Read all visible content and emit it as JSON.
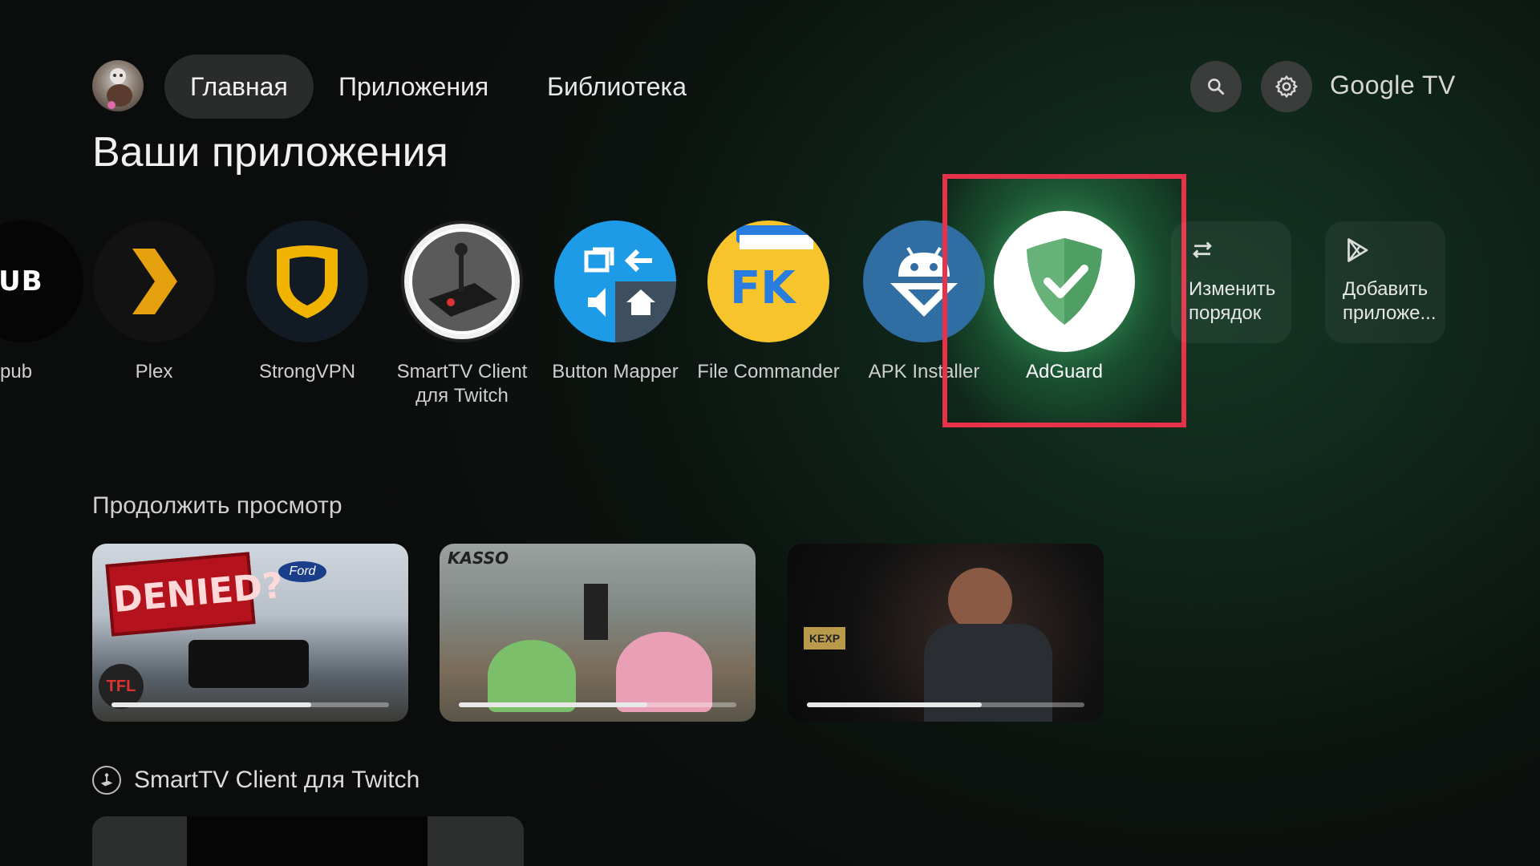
{
  "nav": {
    "tabs": [
      {
        "label": "Главная",
        "active": true
      },
      {
        "label": "Приложения",
        "active": false
      },
      {
        "label": "Библиотека",
        "active": false
      }
    ],
    "search_icon": "search-icon",
    "settings_icon": "gear-icon",
    "brand": "Google TV"
  },
  "apps_section": {
    "title": "Ваши приложения",
    "apps": [
      {
        "label": "pub",
        "icon_text": "PUB"
      },
      {
        "label": "Plex"
      },
      {
        "label": "StrongVPN"
      },
      {
        "label": "SmartTV Client для Twitch"
      },
      {
        "label": "Button Mapper"
      },
      {
        "label": "File Commander",
        "icon_text": "FK"
      },
      {
        "label": "APK Installer"
      },
      {
        "label": "AdGuard",
        "focused": true
      }
    ],
    "actions": [
      {
        "label": "Изменить порядок",
        "icon": "reorder-icon"
      },
      {
        "label": "Добавить приложе...",
        "icon": "play-store-icon"
      }
    ],
    "focus_color": "#e8324a"
  },
  "continue_section": {
    "title": "Продолжить просмотр",
    "items": [
      {
        "overlay_text": "DENIED?",
        "badge": "Ford",
        "corner": "TFL",
        "progress": 0.72
      },
      {
        "overlay_text": "KASSO",
        "progress": 0.68
      },
      {
        "overlay_text": "KEXP",
        "progress": 0.63
      }
    ]
  },
  "twitch_section": {
    "title": "SmartTV Client для Twitch"
  }
}
